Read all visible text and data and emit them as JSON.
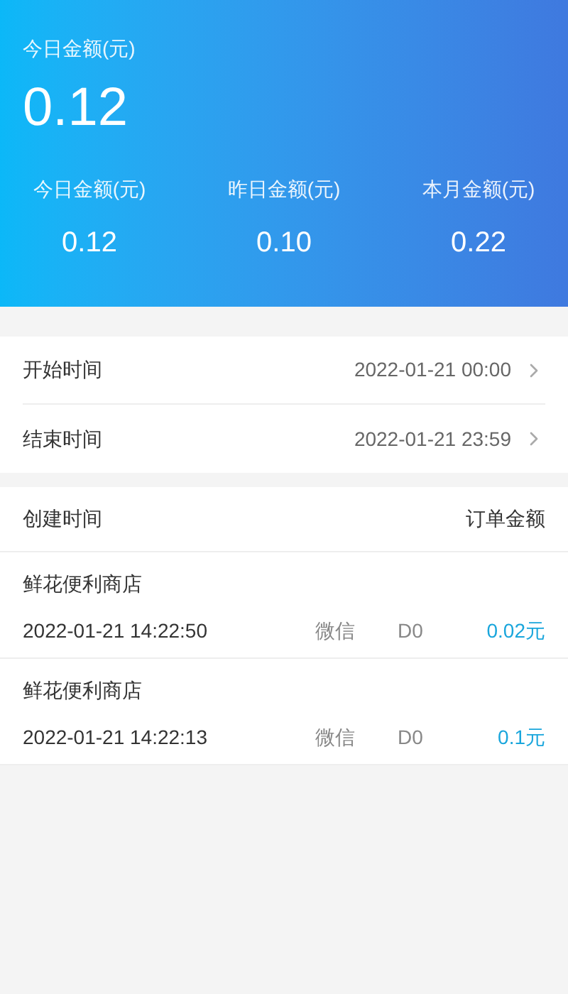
{
  "summary": {
    "title": "今日金额(元)",
    "amount": "0.12",
    "stats": [
      {
        "label": "今日金额(元)",
        "value": "0.12"
      },
      {
        "label": "昨日金额(元)",
        "value": "0.10"
      },
      {
        "label": "本月金额(元)",
        "value": "0.22"
      }
    ]
  },
  "filters": [
    {
      "label": "开始时间",
      "value": "2022-01-21 00:00"
    },
    {
      "label": "结束时间",
      "value": "2022-01-21 23:59"
    }
  ],
  "orders": {
    "columns": [
      "创建时间",
      "订单金额"
    ],
    "rows": [
      {
        "store": "鲜花便利商店",
        "time": "2022-01-21 14:22:50",
        "channel": "微信",
        "settlement": "D0",
        "amount": "0.02元"
      },
      {
        "store": "鲜花便利商店",
        "time": "2022-01-21 14:22:13",
        "channel": "微信",
        "settlement": "D0",
        "amount": "0.1元"
      }
    ]
  }
}
